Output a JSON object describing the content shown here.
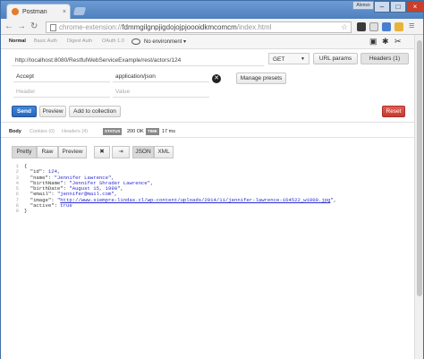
{
  "browser": {
    "tab_title": "Postman",
    "user_button": "Alonso",
    "address_prefix": "chrome-extension://",
    "address_main": "fdmmgilgnpjigdojojpjoooidkmcomcm",
    "address_suffix": "/index.html"
  },
  "env": {
    "tabs": [
      "Normal",
      "Basic Auth",
      "Digest Auth",
      "OAuth 1.0"
    ],
    "active": "Normal",
    "environment": "No environment",
    "environment_arrow": "▾"
  },
  "request": {
    "url": "http://localhost:8080/RestfulWebServiceExample/rest/actors/124",
    "method": "GET",
    "url_params_label": "URL params",
    "headers_label": "Headers (1)",
    "headers": [
      {
        "key": "Accept",
        "value": "application/json"
      }
    ],
    "header_placeholder": "Header",
    "value_placeholder": "Value",
    "manage_presets": "Manage presets"
  },
  "actions": {
    "send": "Send",
    "preview": "Preview",
    "add_to_collection": "Add to collection",
    "reset": "Reset"
  },
  "response": {
    "tabs": [
      "Body",
      "Cookies (0)",
      "Headers (4)"
    ],
    "active_tab": "Body",
    "status_label": "STATUS",
    "status_value": "200 OK",
    "time_label": "TIME",
    "time_value": "17 ms",
    "formats": [
      "Pretty",
      "Raw",
      "Preview"
    ],
    "active_format": "Pretty",
    "types": [
      "JSON",
      "XML"
    ],
    "active_type": "JSON",
    "lines": [
      {
        "no": "1",
        "parts": [
          [
            "p",
            "{"
          ]
        ]
      },
      {
        "no": "2",
        "parts": [
          [
            "k",
            "  \"id\""
          ],
          [
            "p",
            ": "
          ],
          [
            "n",
            "124"
          ],
          [
            "p",
            ","
          ]
        ]
      },
      {
        "no": "3",
        "parts": [
          [
            "k",
            "  \"name\""
          ],
          [
            "p",
            ": "
          ],
          [
            "s",
            "\"Jennifer Lawrence\""
          ],
          [
            "p",
            ","
          ]
        ]
      },
      {
        "no": "4",
        "parts": [
          [
            "k",
            "  \"birthName\""
          ],
          [
            "p",
            ": "
          ],
          [
            "s",
            "\"Jennifer Shrader Lawrence\""
          ],
          [
            "p",
            ","
          ]
        ]
      },
      {
        "no": "5",
        "parts": [
          [
            "k",
            "  \"birthDate\""
          ],
          [
            "p",
            ": "
          ],
          [
            "s",
            "\"August 15, 1990\""
          ],
          [
            "p",
            ","
          ]
        ]
      },
      {
        "no": "6",
        "parts": [
          [
            "k",
            "  \"email\""
          ],
          [
            "p",
            ": "
          ],
          [
            "s",
            "\"jennifer@mail.com\""
          ],
          [
            "p",
            ","
          ]
        ]
      },
      {
        "no": "7",
        "parts": [
          [
            "k",
            "  \"image\""
          ],
          [
            "p",
            ": "
          ],
          [
            "s",
            "\""
          ],
          [
            "lk",
            "http://www.siempre-lindas.cl/wp-content/uploads/2014/11/jennifer-lawrence-164522_w1000.jpg"
          ],
          [
            "s",
            "\""
          ],
          [
            "p",
            ","
          ]
        ]
      },
      {
        "no": "8",
        "parts": [
          [
            "k",
            "  \"active\""
          ],
          [
            "p",
            ": "
          ],
          [
            "n",
            "true"
          ]
        ]
      },
      {
        "no": "9",
        "parts": [
          [
            "p",
            "}"
          ]
        ]
      }
    ]
  }
}
